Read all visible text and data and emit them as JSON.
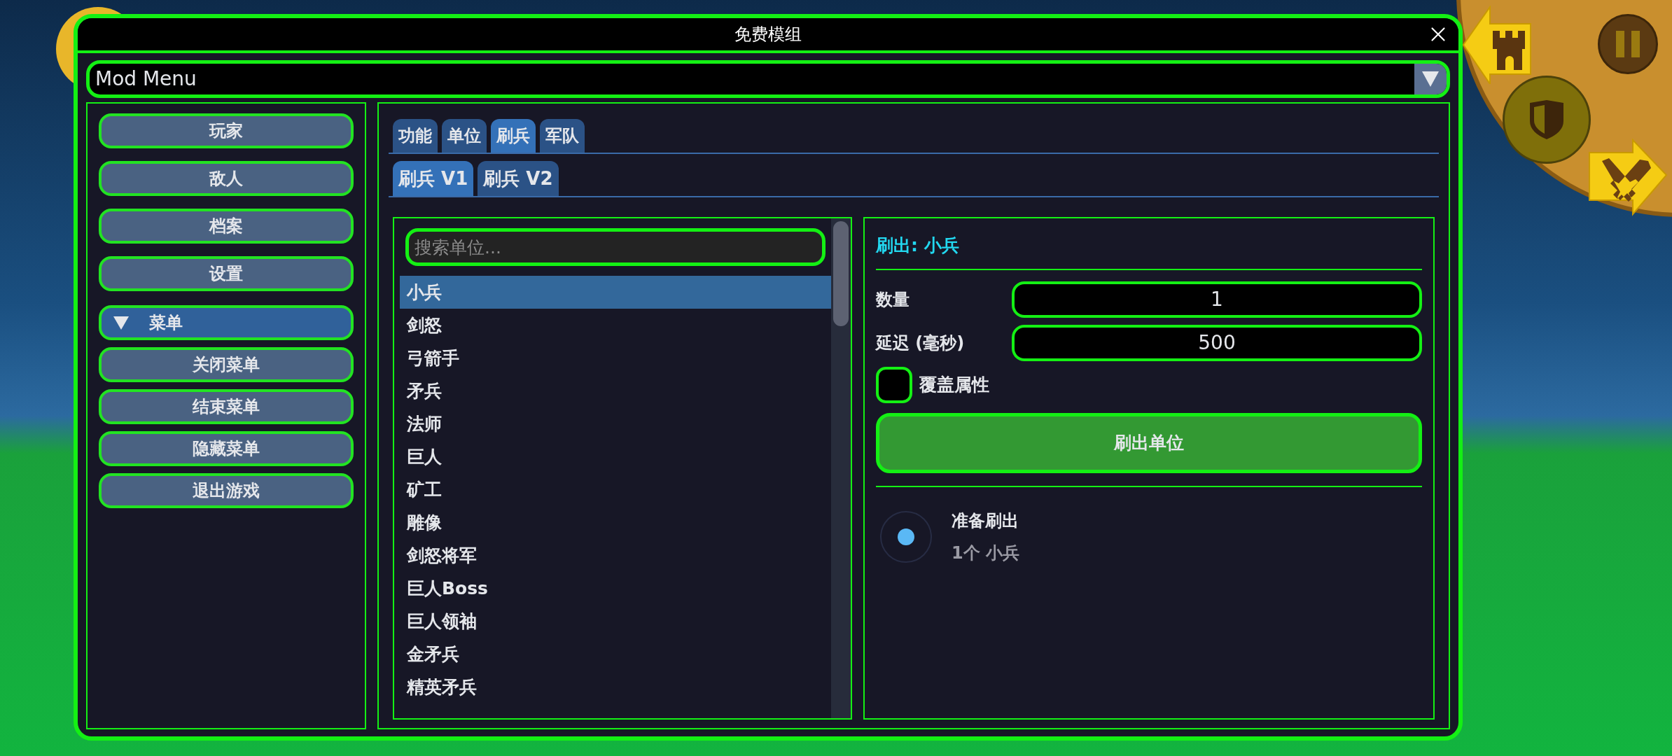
{
  "window": {
    "title": "免费模组"
  },
  "dropdown": {
    "value": "Mod Menu",
    "expanded": false
  },
  "sidebar": {
    "items": [
      {
        "label": "玩家",
        "kind": "button"
      },
      {
        "label": "敌人",
        "kind": "button"
      },
      {
        "label": "档案",
        "kind": "button"
      },
      {
        "label": "设置",
        "kind": "button"
      },
      {
        "label": "菜单",
        "kind": "section",
        "expanded": true
      },
      {
        "label": "关闭菜单",
        "kind": "subbutton"
      },
      {
        "label": "结束菜单",
        "kind": "subbutton"
      },
      {
        "label": "隐藏菜单",
        "kind": "subbutton"
      },
      {
        "label": "退出游戏",
        "kind": "subbutton"
      }
    ]
  },
  "tabs": [
    {
      "label": "功能",
      "selected": false
    },
    {
      "label": "单位",
      "selected": false
    },
    {
      "label": "刷兵",
      "selected": true
    },
    {
      "label": "军队",
      "selected": false
    }
  ],
  "subtabs": [
    {
      "label": "刷兵 V1",
      "selected": true
    },
    {
      "label": "刷兵 V2",
      "selected": false
    }
  ],
  "search": {
    "placeholder": "搜索单位..."
  },
  "units": [
    {
      "label": "小兵",
      "selected": true
    },
    {
      "label": "剑怒",
      "selected": false
    },
    {
      "label": "弓箭手",
      "selected": false
    },
    {
      "label": "矛兵",
      "selected": false
    },
    {
      "label": "法师",
      "selected": false
    },
    {
      "label": "巨人",
      "selected": false
    },
    {
      "label": "矿工",
      "selected": false
    },
    {
      "label": "雕像",
      "selected": false
    },
    {
      "label": "剑怒将军",
      "selected": false
    },
    {
      "label": "巨人Boss",
      "selected": false
    },
    {
      "label": "巨人领袖",
      "selected": false
    },
    {
      "label": "金矛兵",
      "selected": false
    },
    {
      "label": "精英矛兵",
      "selected": false
    }
  ],
  "spawn": {
    "title": "刷出: 小兵",
    "fields": [
      {
        "label": "数量",
        "value": "1"
      },
      {
        "label": "延迟 (毫秒)",
        "value": "500"
      }
    ],
    "override": {
      "label": "覆盖属性",
      "checked": false
    },
    "button": "刷出单位",
    "status": {
      "title": "准备刷出",
      "detail": "1个 小兵",
      "active": true
    }
  }
}
